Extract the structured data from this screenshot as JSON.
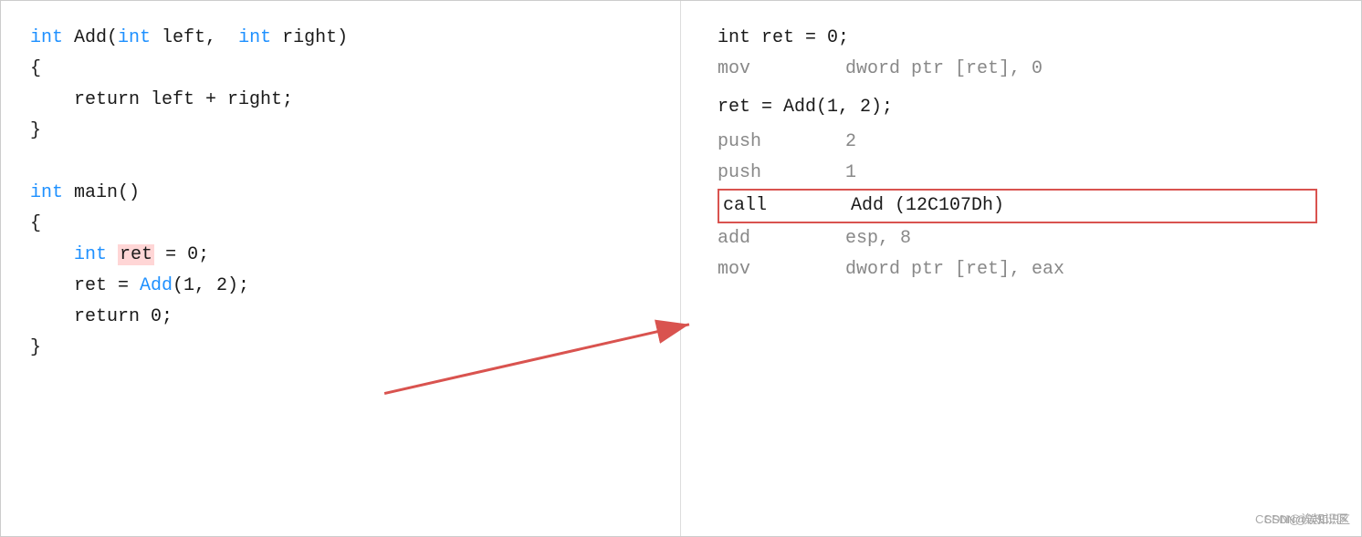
{
  "left": {
    "code_lines": [
      {
        "id": "l1",
        "parts": [
          {
            "text": "int",
            "class": "kw"
          },
          {
            "text": " Add(",
            "class": ""
          },
          {
            "text": "int",
            "class": "kw"
          },
          {
            "text": " left,  ",
            "class": ""
          },
          {
            "text": "int",
            "class": "kw"
          },
          {
            "text": " right)",
            "class": ""
          }
        ]
      },
      {
        "id": "l2",
        "text": "{",
        "class": ""
      },
      {
        "id": "l3",
        "text": ""
      },
      {
        "id": "l4",
        "text": "    return left + right;",
        "class": ""
      },
      {
        "id": "l5",
        "text": "}"
      },
      {
        "id": "l6",
        "text": ""
      },
      {
        "id": "l7",
        "text": ""
      },
      {
        "id": "l8",
        "parts": [
          {
            "text": "int",
            "class": "kw"
          },
          {
            "text": " main()",
            "class": ""
          }
        ]
      },
      {
        "id": "l9",
        "text": "{"
      },
      {
        "id": "l10",
        "text": ""
      },
      {
        "id": "l11",
        "text": "    int ret = 0;",
        "highlight_ret": true
      },
      {
        "id": "l12",
        "text": "    ret = Add(1, 2);",
        "highlight_add": true
      },
      {
        "id": "l13",
        "text": "    return 0;"
      },
      {
        "id": "l14",
        "text": "}"
      }
    ]
  },
  "right": {
    "asm_lines": [
      {
        "id": "a1",
        "source": "int ret = 0;",
        "is_source": true
      },
      {
        "id": "a2",
        "instr": "mov",
        "operand": "dword ptr [ret], 0"
      },
      {
        "id": "a3",
        "spacer": true
      },
      {
        "id": "a4",
        "source": "ret = Add(1, 2);",
        "is_source": true
      },
      {
        "id": "a5",
        "spacer": true
      },
      {
        "id": "a6",
        "instr": "push",
        "operand": "2"
      },
      {
        "id": "a7",
        "instr": "push",
        "operand": "1"
      },
      {
        "id": "a8",
        "instr": "call",
        "operand": "Add (12C107Dh)",
        "highlighted": true
      },
      {
        "id": "a9",
        "instr": "add",
        "operand": "esp, 8"
      },
      {
        "id": "a10",
        "instr": "mov",
        "operand": "dword ptr [ret], eax"
      }
    ]
  },
  "watermark": "CSDN@诶知识区"
}
